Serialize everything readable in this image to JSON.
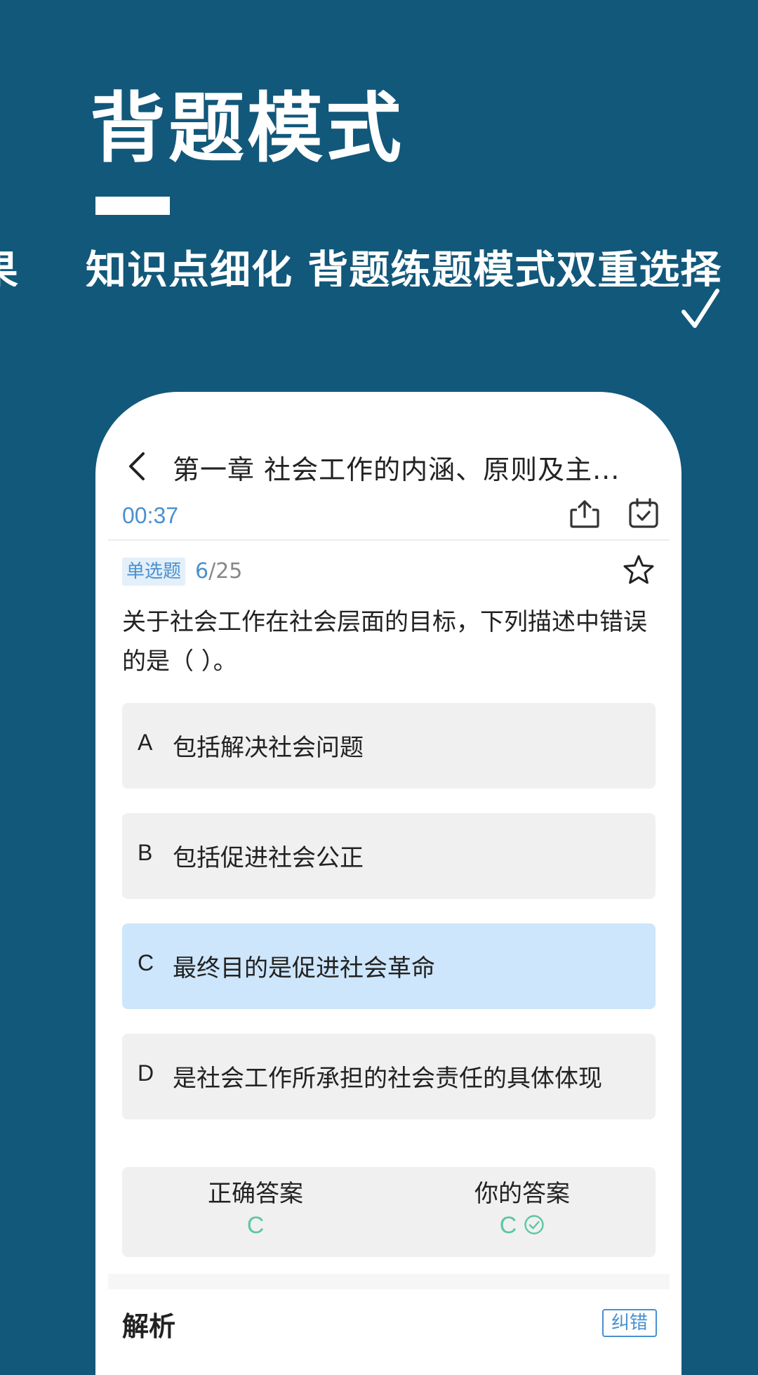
{
  "banner": {
    "title": "背题模式",
    "prev_fragment": "果",
    "subtitle": "知识点细化  背题练题模式双重选择"
  },
  "nav": {
    "title": "第一章  社会工作的内涵、原则及主..."
  },
  "toolbar": {
    "timer": "00:37"
  },
  "question": {
    "type": "单选题",
    "current": "6",
    "total_sep": "/25",
    "text": "关于社会工作在社会层面的目标，下列描述中错误的是（    ）。"
  },
  "options": [
    {
      "letter": "A",
      "text": "包括解决社会问题"
    },
    {
      "letter": "B",
      "text": "包括促进社会公正"
    },
    {
      "letter": "C",
      "text": "最终目的是促进社会革命"
    },
    {
      "letter": "D",
      "text": "是社会工作所承担的社会责任的具体体现"
    }
  ],
  "answer": {
    "correct_label": "正确答案",
    "correct_value": "C",
    "yours_label": "你的答案",
    "yours_value": "C"
  },
  "analysis": {
    "title": "解析",
    "report_label": "纠错"
  },
  "colors": {
    "background": "#12587a",
    "accent": "#4a90d0",
    "selected": "#cde6fb",
    "correct": "#5cc7a0"
  }
}
